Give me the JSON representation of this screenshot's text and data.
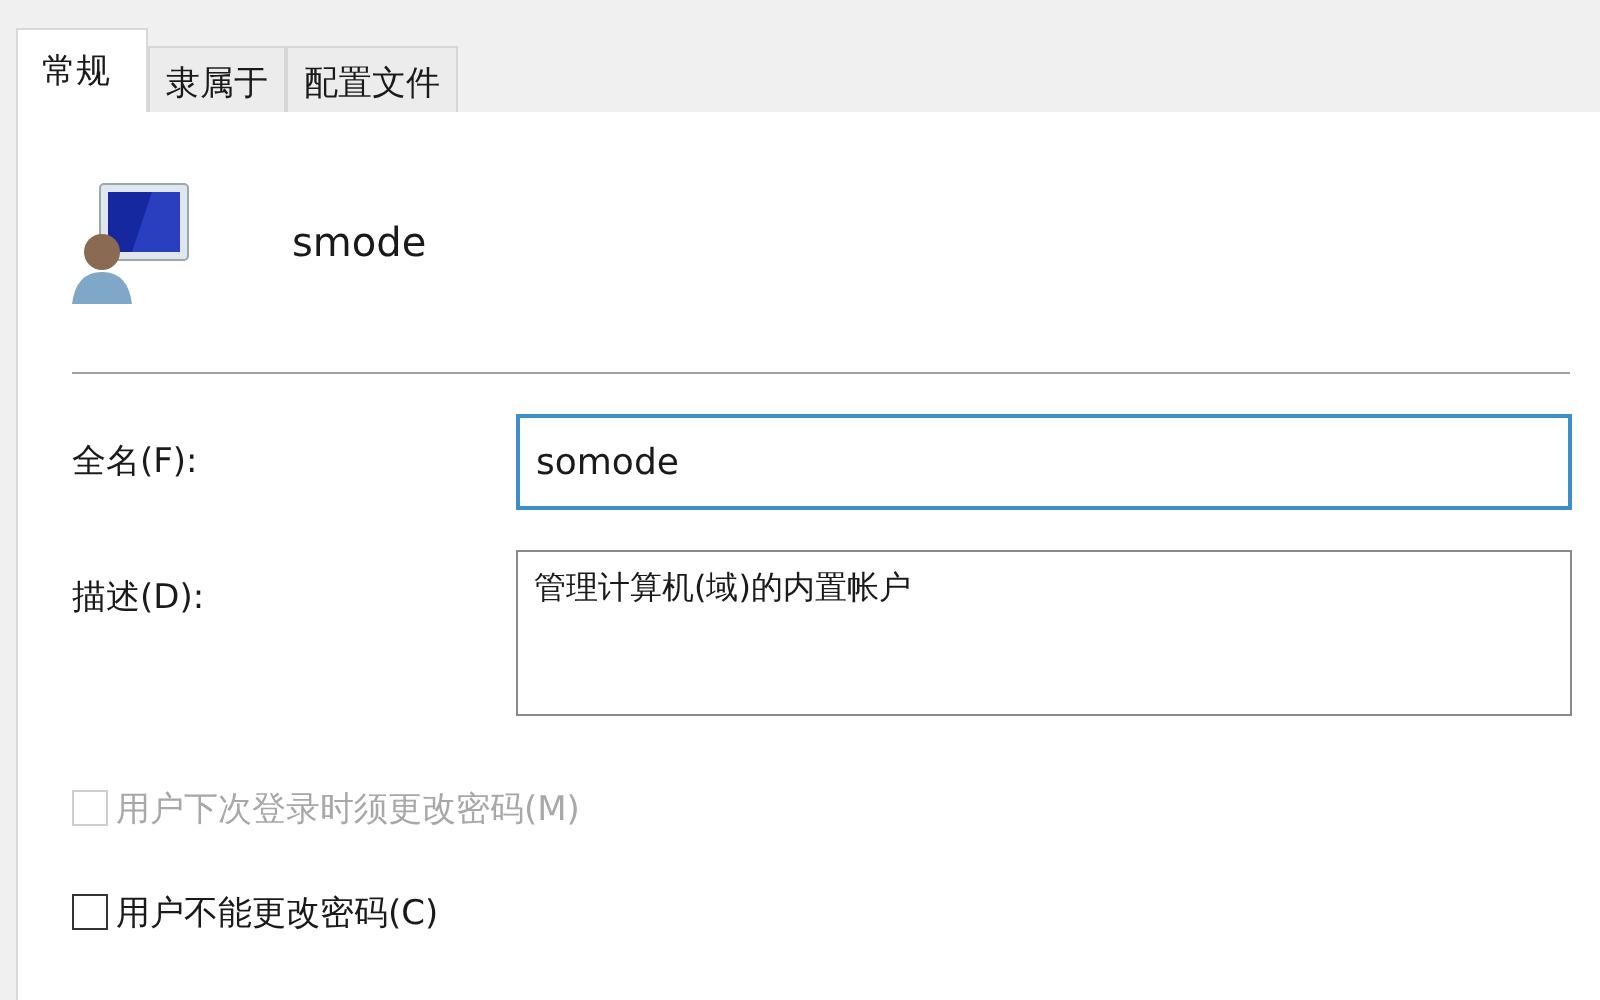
{
  "tabs": [
    {
      "label": "常规",
      "selected": true
    },
    {
      "label": "隶属于",
      "selected": false
    },
    {
      "label": "配置文件",
      "selected": false
    }
  ],
  "user": {
    "name": "smode"
  },
  "fields": [
    {
      "kind": "line",
      "label": "全名(F):",
      "value": "somode",
      "focused": true
    },
    {
      "kind": "area",
      "label": "描述(D):",
      "value": "管理计算机(域)的内置帐户",
      "focused": false
    }
  ],
  "options": [
    {
      "label": "用户下次登录时须更改密码(M)",
      "checked": false,
      "disabled": true
    },
    {
      "label": "用户不能更改密码(C)",
      "checked": false,
      "disabled": false
    }
  ]
}
